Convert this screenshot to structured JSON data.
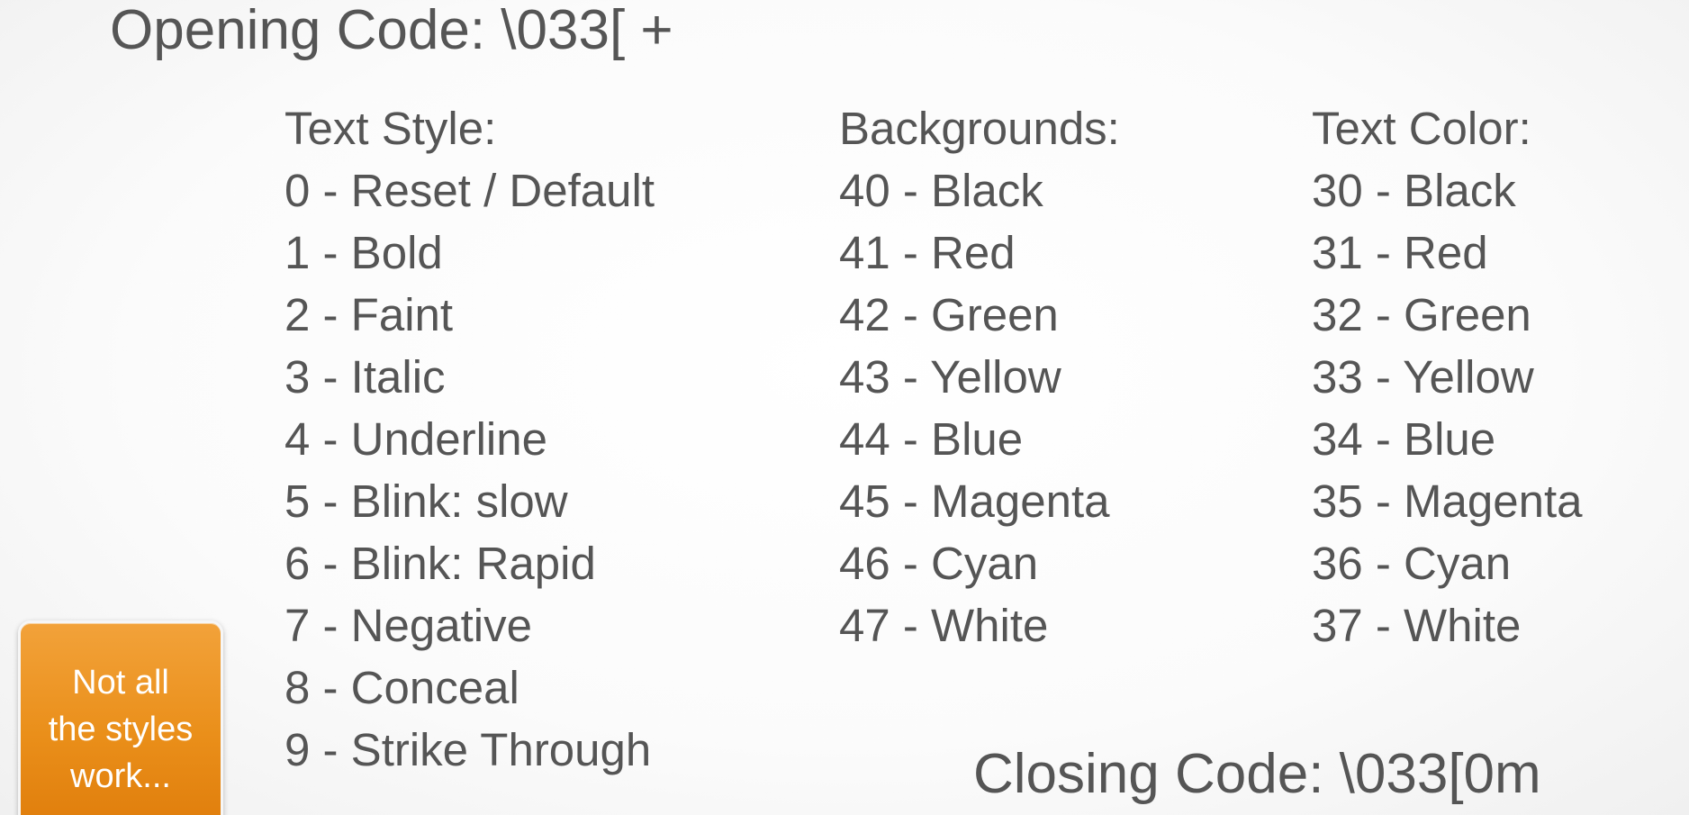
{
  "opening_code": "Opening Code: \\033[ +",
  "text_style": {
    "header": "Text Style:",
    "items": [
      "0 - Reset / Default",
      "1 - Bold",
      "2 - Faint",
      "3 - Italic",
      "4 - Underline",
      "5 - Blink: slow",
      "6 - Blink: Rapid",
      "7 - Negative",
      "8 - Conceal",
      "9 - Strike Through"
    ]
  },
  "backgrounds": {
    "header": "Backgrounds:",
    "items": [
      "40 - Black",
      "41 - Red",
      "42 - Green",
      "43 - Yellow",
      "44 - Blue",
      "45 - Magenta",
      "46 - Cyan",
      "47 - White"
    ]
  },
  "text_color": {
    "header": "Text Color:",
    "items": [
      "30 - Black",
      "31 - Red",
      "32 - Green",
      "33 - Yellow",
      "34 - Blue",
      "35 - Magenta",
      "36 - Cyan",
      "37 - White"
    ]
  },
  "closing_code": "Closing Code: \\033[0m",
  "note": {
    "lines": [
      "Not all",
      "the styles",
      "work..."
    ]
  },
  "colors": {
    "text": "#555555",
    "note_orange": "#ea8f1a",
    "note_text": "#ffffff",
    "background": "#ffffff"
  }
}
